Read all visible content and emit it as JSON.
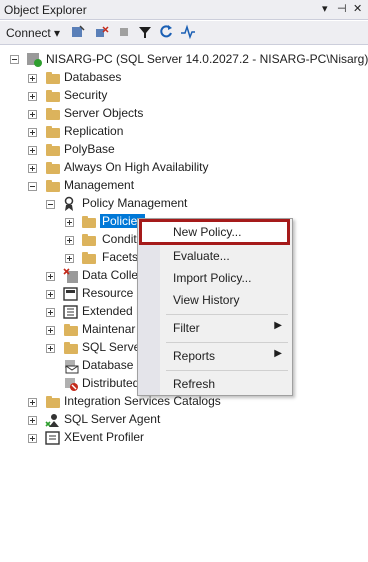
{
  "window": {
    "title": "Object Explorer",
    "buttons": [
      "▾",
      "⊣",
      "✕"
    ]
  },
  "toolbar": {
    "connect_label": "Connect ▾",
    "tools": [
      "connect-server-icon",
      "disconnect-icon",
      "stop-icon",
      "filter-icon",
      "refresh-icon",
      "activity-icon"
    ]
  },
  "tree": {
    "root": "NISARG-PC (SQL Server 14.0.2027.2 - NISARG-PC\\Nisarg)",
    "databases": "Databases",
    "security": "Security",
    "server_objects": "Server Objects",
    "replication": "Replication",
    "polybase": "PolyBase",
    "always_on": "Always On High Availability",
    "management": "Management",
    "policy_management": "Policy Management",
    "policies": "Policies",
    "conditions": "Conditions",
    "facets": "Facets",
    "data_collection": "Data Colle",
    "resource_governor": "Resource G",
    "extended_events": "Extended E",
    "maintenance_plans": "Maintenar",
    "sql_server_logs": "SQL Server",
    "database_mail": "Database M",
    "distributed_tx": "Distributed",
    "integration_services": "Integration Services Catalogs",
    "sql_agent": "SQL Server Agent",
    "xevent_profiler": "XEvent Profiler"
  },
  "context_menu": {
    "new_policy": "New Policy...",
    "evaluate": "Evaluate...",
    "import_policy": "Import Policy...",
    "view_history": "View History",
    "filter": "Filter",
    "reports": "Reports",
    "refresh": "Refresh",
    "submenu_arrow": "▶"
  },
  "colors": {
    "selection": "#0078d7",
    "highlight_border": "#a51a1a",
    "folder": "#dcb35c"
  }
}
